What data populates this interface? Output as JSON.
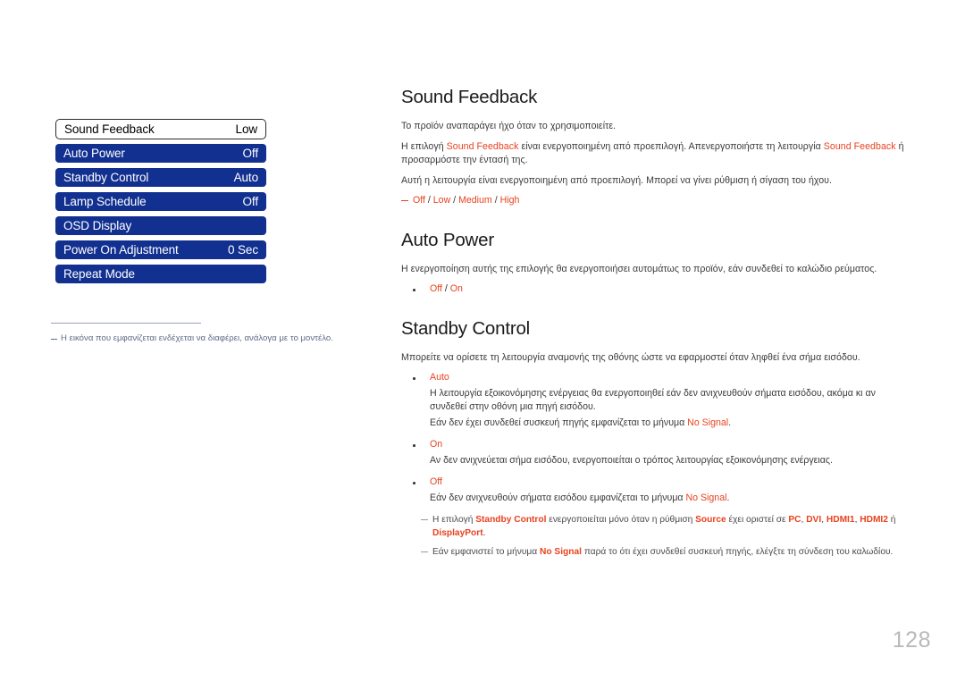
{
  "osd_menu": {
    "rows": [
      {
        "label": "Sound Feedback",
        "value": "Low",
        "selected": true
      },
      {
        "label": "Auto Power",
        "value": "Off",
        "selected": false
      },
      {
        "label": "Standby Control",
        "value": "Auto",
        "selected": false
      },
      {
        "label": "Lamp Schedule",
        "value": "Off",
        "selected": false
      },
      {
        "label": "OSD Display",
        "value": "",
        "selected": false
      },
      {
        "label": "Power On Adjustment",
        "value": "0 Sec",
        "selected": false
      },
      {
        "label": "Repeat Mode",
        "value": "",
        "selected": false
      }
    ],
    "accent_blue": "#123090",
    "selected_bg": "#ffffff",
    "selected_border": "#2b2b2b"
  },
  "left_note": {
    "text": "Η εικόνα που εμφανίζεται ενδέχεται να διαφέρει, ανάλογα με το μοντέλο.",
    "color": "#5f6b86"
  },
  "sections": {
    "sound_feedback": {
      "title": "Sound Feedback",
      "p1": "Το προϊόν αναπαράγει ήχο όταν το χρησιμοποιείτε.",
      "p2_part1": "Η επιλογή ",
      "p2_hl1": "Sound Feedback",
      "p2_part2": " είναι ενεργοποιημένη από προεπιλογή. Απενεργοποιήστε τη λειτουργία ",
      "p2_hl2": "Sound Feedback",
      "p2_part3": " ή προσαρμόστε την έντασή της.",
      "p3": "Αυτή η λειτουργία είναι ενεργοποιημένη από προεπιλογή. Μπορεί να γίνει ρύθμιση ή σίγαση του ήχου.",
      "options": [
        "Off",
        "Low",
        "Medium",
        "High"
      ],
      "options_separator": " / "
    },
    "auto_power": {
      "title": "Auto Power",
      "p1": "Η ενεργοποίηση αυτής της επιλογής θα ενεργοποιήσει αυτομάτως το προϊόν, εάν συνδεθεί το καλώδιο ρεύματος.",
      "options": [
        "Off",
        "On"
      ],
      "options_separator": " / "
    },
    "standby_control": {
      "title": "Standby Control",
      "p1": "Μπορείτε να ορίσετε τη λειτουργία αναμονής της οθόνης ώστε να εφαρμοστεί όταν ληφθεί ένα σήμα εισόδου.",
      "bullets": [
        {
          "label": "Auto",
          "lines": [
            "Η λειτουργία εξοικονόμησης ενέργειας θα ενεργοποιηθεί εάν δεν ανιχνευθούν σήματα εισόδου, ακόμα κι αν συνδεθεί στην οθόνη μια πηγή εισόδου."
          ],
          "line_with_hl": {
            "before": "Εάν δεν έχει συνδεθεί συσκευή πηγής εμφανίζεται το μήνυμα ",
            "hl": "No Signal",
            "after": "."
          }
        },
        {
          "label": "On",
          "lines": [
            "Αν δεν ανιχνεύεται σήμα εισόδου, ενεργοποιείται ο τρόπος λειτουργίας εξοικονόμησης ενέργειας."
          ],
          "line_with_hl": null
        },
        {
          "label": "Off",
          "lines": [],
          "line_with_hl": {
            "before": "Εάν δεν ανιχνευθούν σήματα εισόδου εμφανίζεται το μήνυμα ",
            "hl": "No Signal",
            "after": "."
          }
        }
      ],
      "notes": [
        {
          "seg1": "Η επιλογή ",
          "hl1": "Standby Control",
          "seg2": " ενεργοποιείται μόνο όταν η ρύθμιση ",
          "hl2": "Source",
          "seg3": " έχει οριστεί σε ",
          "hl3": "PC",
          "seg4": ", ",
          "hl4": "DVI",
          "seg5": ", ",
          "hl5": "HDMI1",
          "seg6": ", ",
          "hl6": "HDMI2",
          "seg7": " ή ",
          "hl7": "DisplayPort",
          "seg8": "."
        },
        {
          "seg1": "Εάν εμφανιστεί το μήνυμα ",
          "hl1": "No Signal",
          "seg2": " παρά το ότι έχει συνδεθεί συσκευή πηγής, ελέγξτε τη σύνδεση του καλωδίου.",
          "hl2": "",
          "seg3": "",
          "hl3": "",
          "seg4": "",
          "hl4": "",
          "seg5": "",
          "hl5": "",
          "seg6": "",
          "hl6": "",
          "seg7": "",
          "hl7": "",
          "seg8": ""
        }
      ]
    }
  },
  "page_number": "128",
  "colors": {
    "highlight": "#e8421f",
    "menu_blue": "#123090",
    "page_number": "#b9b9b9"
  }
}
